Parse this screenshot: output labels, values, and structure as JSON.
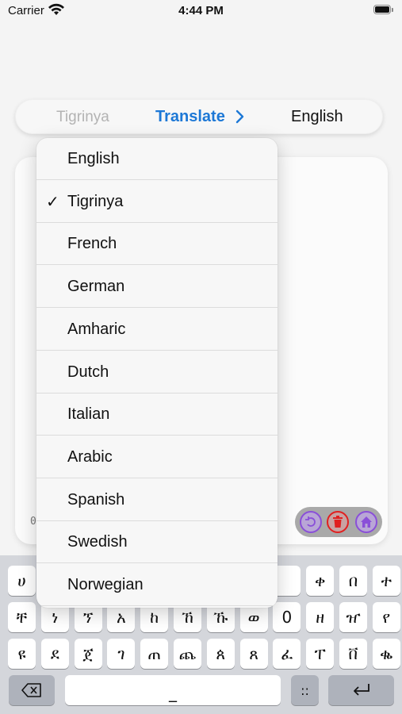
{
  "status_bar": {
    "carrier": "Carrier",
    "time": "4:44 PM"
  },
  "language_bar": {
    "source_language": "Tigrinya",
    "translate_label": "Translate",
    "target_language": "English"
  },
  "editor": {
    "char_count": "0"
  },
  "actions": [
    {
      "icon": "undo-icon",
      "color": "#8a4fd8"
    },
    {
      "icon": "trash-icon",
      "color": "#e02020"
    },
    {
      "icon": "home-icon",
      "color": "#8a4fd8"
    }
  ],
  "language_menu": {
    "selected": "Tigrinya",
    "items": [
      "English",
      "Tigrinya",
      "French",
      "German",
      "Amharic",
      "Dutch",
      "Italian",
      "Arabic",
      "Spanish",
      "Swedish",
      "Norwegian"
    ]
  },
  "keyboard": {
    "row1": [
      "ሀ",
      "",
      "",
      "",
      "",
      "",
      "",
      "",
      "",
      "ቀ",
      "በ",
      "ተ"
    ],
    "row2": [
      "ቸ",
      "ነ",
      "ኘ",
      "አ",
      "ከ",
      "ኸ",
      "ኹ",
      "ወ",
      "0",
      "ዘ",
      "ዠ",
      "የ"
    ],
    "row3": [
      "ዩ",
      "ደ",
      "ጀ",
      "ገ",
      "ጠ",
      "ጨ",
      "ጰ",
      "ጸ",
      "ፈ",
      "ፐ",
      "ቨ",
      "ቈ"
    ],
    "space_label": "_",
    "colon_key": "::"
  }
}
